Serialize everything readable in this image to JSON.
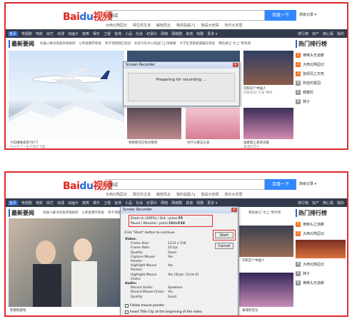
{
  "header": {
    "logo_text": "Bai",
    "logo_paw": "du",
    "logo_cn": "视频",
    "search_value": "测试",
    "search_button": "百度一下",
    "adv_link": "高级记录 ▾",
    "suggestions": [
      "大西北陶园记",
      "陌生的主流",
      "解剖风云",
      "我的是超人J",
      "我是大侦探",
      "快乐大本营"
    ]
  },
  "nav": {
    "items": [
      "首页",
      "电视剧",
      "电影",
      "综艺",
      "动漫",
      "动画片",
      "搞笑",
      "娱乐",
      "卫视",
      "各地",
      "小品",
      "社会",
      "纪录片",
      "网络",
      "网络剧",
      "其他",
      "热剧",
      "更多 ▾"
    ],
    "right": [
      "排行榜",
      "资产",
      "随心看",
      "我的"
    ]
  },
  "sections": {
    "latest": "最新要闻",
    "ranking": "热门排行榜",
    "subtabs_top": [
      "机器人解决周金周请规则",
      "公积金缴存新规",
      "男子领跑网红饭团",
      "女孩汽车冲入校园门上吊跳楼",
      "大学生求职被遇骗局等案",
      "两校被让“水上”更有情"
    ],
    "subtabs_bottom": [
      "机器人解决周金周请规则",
      "公积金缴存新规",
      "男子领跑网红饭团",
      "两校被让“水上”更有情"
    ]
  },
  "captions_top": [
    "汽车撞故波音787了",
    "打从为了一生学到大飞机",
    "林更新在红毯大晒单",
    "为什么看这么多",
    "刘阳又个中国人",
    "刘更高的“头发”事件",
    "张家辉上演逆光版",
    "毒液的无论"
  ],
  "captions_bottom": [
    "陈锦明游戏",
    "林更新在红毯大晒单",
    "刘阳又个中国人",
    "毒液的无论"
  ],
  "ranking_top": [
    "律奥头无道歉",
    "大西北陶园记",
    "独领风之无死",
    "阿佳的蒙园",
    "典雅的",
    "随子"
  ],
  "ranking_bottom": [
    "律奥头之道歉",
    "大西北陶园记",
    "",
    "大西北陶园记",
    "随子",
    "律奥头无道歉"
  ],
  "dialog1": {
    "title": "Screen Recorder",
    "message": "Preparing for recording ..."
  },
  "dialog2": {
    "title": "Screen Recorder",
    "zoom_label": "Zoom In (200%) / Out : press",
    "zoom_key": "F5",
    "pause_label": "Pause / Resume : press",
    "pause_key": "Ctrl+F10",
    "hint": "Click \"Start\" button to continue",
    "start_btn": "Start",
    "cancel_btn": "Cancel",
    "video_heading": "Video:",
    "video": [
      [
        "Frame Size:",
        "1212 x 516"
      ],
      [
        "Frame Rate:",
        "10 fps"
      ],
      [
        "Quality:",
        "Good"
      ],
      [
        "Capture Mouse Pointer:",
        "Yes"
      ],
      [
        "Highlight Mouse Pointer:",
        "Yes"
      ],
      [
        "Highlight Mouse Clicks:",
        "Yes (Style: Circle 6)"
      ]
    ],
    "audio_heading": "Audio:",
    "audio": [
      [
        "Record Audio:",
        "Speakers"
      ],
      [
        "Record Mouse Clicks:",
        "Yes"
      ],
      [
        "Quality:",
        "Good"
      ]
    ],
    "check1": "Follow mouse pointer",
    "check2": "Insert Title Clip at the beginning of the video"
  }
}
